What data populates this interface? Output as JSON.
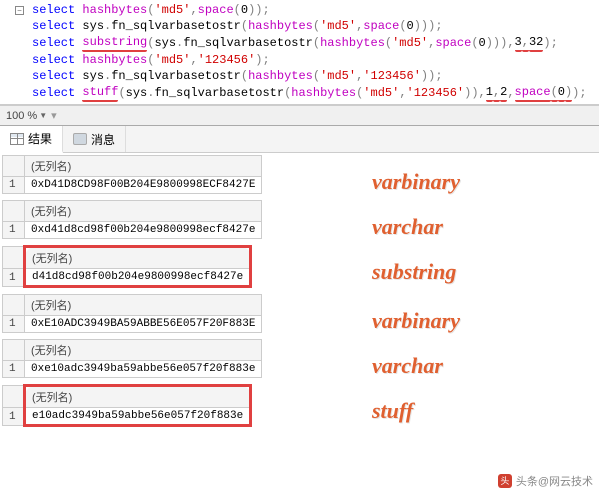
{
  "editor": {
    "lines": [
      [
        {
          "t": "select ",
          "c": "kw"
        },
        {
          "t": "hashbytes",
          "c": "fn"
        },
        {
          "t": "(",
          "c": "paren"
        },
        {
          "t": "'md5'",
          "c": "str"
        },
        {
          "t": ",",
          "c": "punct"
        },
        {
          "t": "space",
          "c": "fn"
        },
        {
          "t": "(",
          "c": "paren"
        },
        {
          "t": "0",
          "c": "num"
        },
        {
          "t": "))",
          "c": "paren"
        },
        {
          "t": ";",
          "c": "punct"
        }
      ],
      [
        {
          "t": "select ",
          "c": "kw"
        },
        {
          "t": "sys",
          "c": "plain"
        },
        {
          "t": ".",
          "c": "punct"
        },
        {
          "t": "fn_sqlvarbasetostr",
          "c": "plain"
        },
        {
          "t": "(",
          "c": "paren"
        },
        {
          "t": "hashbytes",
          "c": "fn"
        },
        {
          "t": "(",
          "c": "paren"
        },
        {
          "t": "'md5'",
          "c": "str"
        },
        {
          "t": ",",
          "c": "punct"
        },
        {
          "t": "space",
          "c": "fn"
        },
        {
          "t": "(",
          "c": "paren"
        },
        {
          "t": "0",
          "c": "num"
        },
        {
          "t": ")))",
          "c": "paren"
        },
        {
          "t": ";",
          "c": "punct"
        }
      ],
      [
        {
          "t": "select ",
          "c": "kw"
        },
        {
          "t": "substring",
          "c": "fn",
          "u": true
        },
        {
          "t": "(",
          "c": "paren"
        },
        {
          "t": "sys",
          "c": "plain"
        },
        {
          "t": ".",
          "c": "punct"
        },
        {
          "t": "fn_sqlvarbasetostr",
          "c": "plain"
        },
        {
          "t": "(",
          "c": "paren"
        },
        {
          "t": "hashbytes",
          "c": "fn"
        },
        {
          "t": "(",
          "c": "paren"
        },
        {
          "t": "'md5'",
          "c": "str"
        },
        {
          "t": ",",
          "c": "punct"
        },
        {
          "t": "space",
          "c": "fn"
        },
        {
          "t": "(",
          "c": "paren"
        },
        {
          "t": "0",
          "c": "num"
        },
        {
          "t": ")))",
          "c": "paren"
        },
        {
          "t": ",",
          "c": "punct"
        },
        {
          "t": "3",
          "c": "num",
          "u": true
        },
        {
          "t": ",",
          "c": "punct",
          "u": true
        },
        {
          "t": "32",
          "c": "num",
          "u": true
        },
        {
          "t": ")",
          "c": "paren"
        },
        {
          "t": ";",
          "c": "punct"
        }
      ],
      [
        {
          "t": "select ",
          "c": "kw"
        },
        {
          "t": "hashbytes",
          "c": "fn"
        },
        {
          "t": "(",
          "c": "paren"
        },
        {
          "t": "'md5'",
          "c": "str"
        },
        {
          "t": ",",
          "c": "punct"
        },
        {
          "t": "'123456'",
          "c": "str"
        },
        {
          "t": ")",
          "c": "paren"
        },
        {
          "t": ";",
          "c": "punct"
        }
      ],
      [
        {
          "t": "select ",
          "c": "kw"
        },
        {
          "t": "sys",
          "c": "plain"
        },
        {
          "t": ".",
          "c": "punct"
        },
        {
          "t": "fn_sqlvarbasetostr",
          "c": "plain"
        },
        {
          "t": "(",
          "c": "paren"
        },
        {
          "t": "hashbytes",
          "c": "fn"
        },
        {
          "t": "(",
          "c": "paren"
        },
        {
          "t": "'md5'",
          "c": "str"
        },
        {
          "t": ",",
          "c": "punct"
        },
        {
          "t": "'123456'",
          "c": "str"
        },
        {
          "t": "))",
          "c": "paren"
        },
        {
          "t": ";",
          "c": "punct"
        }
      ],
      [
        {
          "t": "select ",
          "c": "kw"
        },
        {
          "t": "stuff",
          "c": "fn",
          "u": true
        },
        {
          "t": "(",
          "c": "paren"
        },
        {
          "t": "sys",
          "c": "plain"
        },
        {
          "t": ".",
          "c": "punct"
        },
        {
          "t": "fn_sqlvarbasetostr",
          "c": "plain"
        },
        {
          "t": "(",
          "c": "paren"
        },
        {
          "t": "hashbytes",
          "c": "fn"
        },
        {
          "t": "(",
          "c": "paren"
        },
        {
          "t": "'md5'",
          "c": "str"
        },
        {
          "t": ",",
          "c": "punct"
        },
        {
          "t": "'123456'",
          "c": "str"
        },
        {
          "t": "))",
          "c": "paren"
        },
        {
          "t": ",",
          "c": "punct"
        },
        {
          "t": "1",
          "c": "num",
          "u": true
        },
        {
          "t": ",",
          "c": "punct",
          "u": true
        },
        {
          "t": "2",
          "c": "num",
          "u": true
        },
        {
          "t": ",",
          "c": "punct"
        },
        {
          "t": "space",
          "c": "fn",
          "u": true
        },
        {
          "t": "(",
          "c": "paren",
          "u": true
        },
        {
          "t": "0",
          "c": "num",
          "u": true
        },
        {
          "t": ")",
          "c": "paren",
          "u": true
        },
        {
          "t": ")",
          "c": "paren"
        },
        {
          "t": ";",
          "c": "punct"
        }
      ]
    ]
  },
  "zoom": {
    "value": "100 %"
  },
  "tabs": {
    "results": "结果",
    "messages": "消息"
  },
  "header_nocol": "(无列名)",
  "results": [
    {
      "row": "1",
      "val": "0xD41D8CD98F00B204E9800998ECF8427E",
      "anno": "varbinary",
      "circle": false
    },
    {
      "row": "1",
      "val": "0xd41d8cd98f00b204e9800998ecf8427e",
      "anno": "varchar",
      "circle": false
    },
    {
      "row": "1",
      "val": "d41d8cd98f00b204e9800998ecf8427e",
      "anno": "substring",
      "circle": true
    },
    {
      "row": "1",
      "val": "0xE10ADC3949BA59ABBE56E057F20F883E",
      "anno": "varbinary",
      "circle": false
    },
    {
      "row": "1",
      "val": "0xe10adc3949ba59abbe56e057f20f883e",
      "anno": "varchar",
      "circle": false
    },
    {
      "row": "1",
      "val": "e10adc3949ba59abbe56e057f20f883e",
      "anno": "stuff",
      "circle": true
    }
  ],
  "watermark": "头条@网云技术"
}
